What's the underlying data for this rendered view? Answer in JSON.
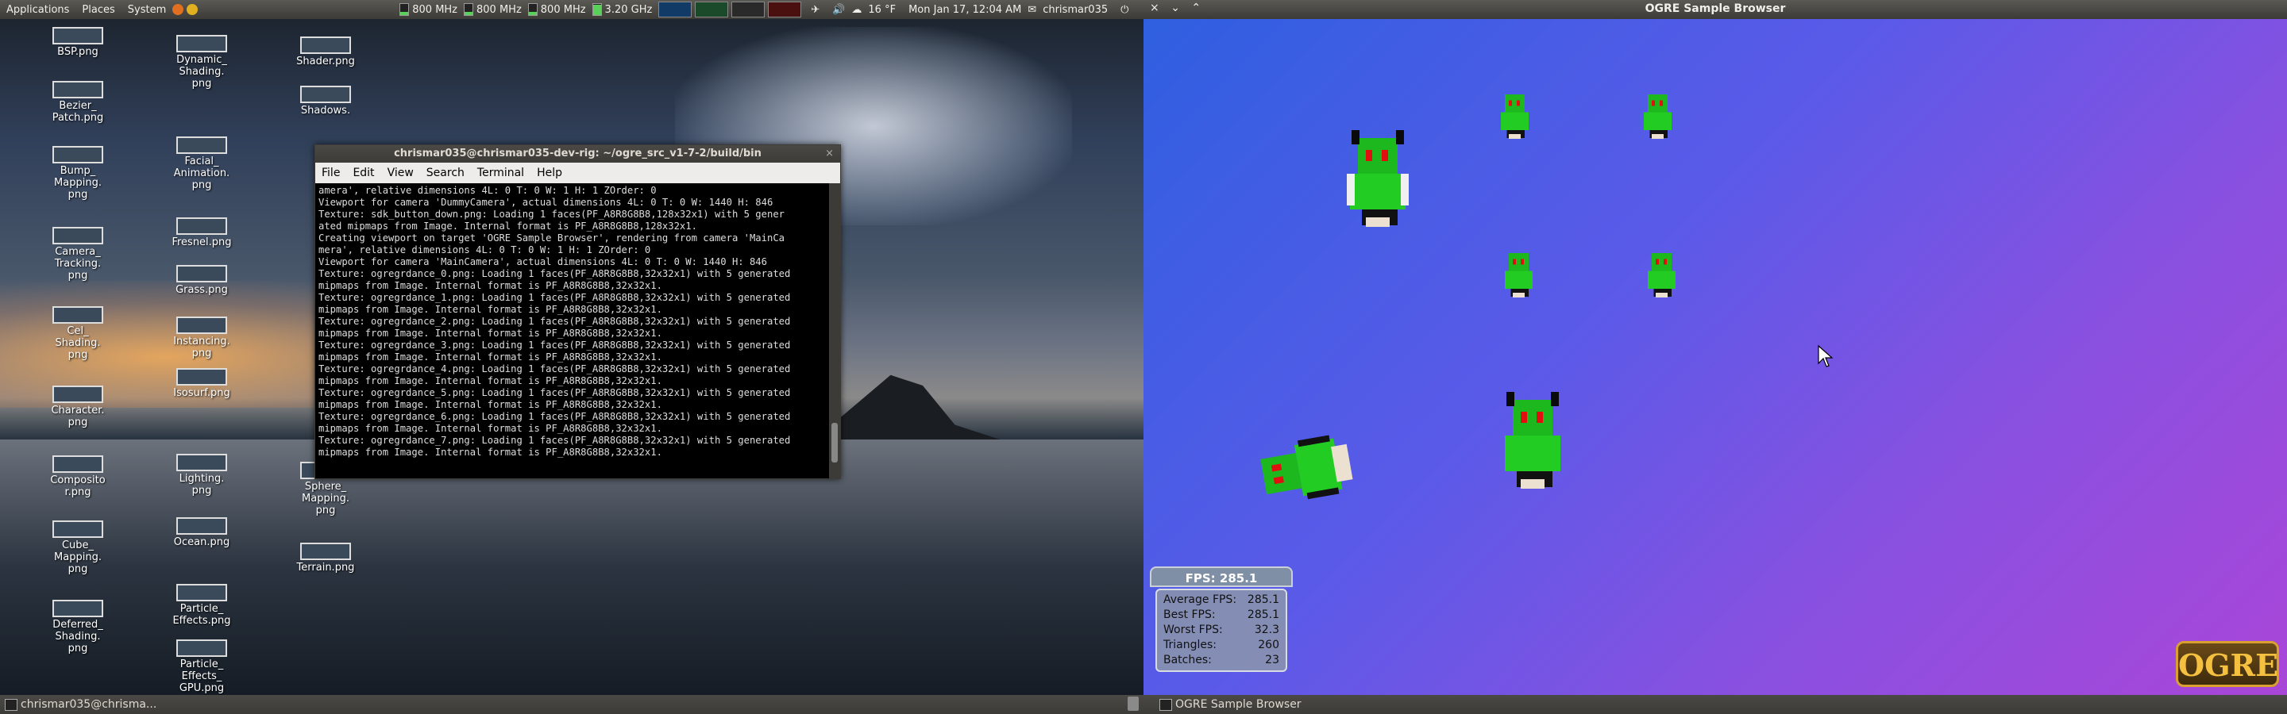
{
  "top_panel": {
    "menus": [
      "Applications",
      "Places",
      "System"
    ],
    "cpu_freqs": [
      "800 MHz",
      "800 MHz",
      "800 MHz",
      "3.20 GHz"
    ],
    "weather": "16 °F",
    "datetime": "Mon Jan 17, 12:04 AM",
    "user": "chrismar035"
  },
  "desktop_icons": [
    "BSP.png",
    "Bezier_\nPatch.png",
    "Bump_\nMapping.\npng",
    "Camera_\nTracking.\npng",
    "Cel_\nShading.\npng",
    "Character.\npng",
    "Composito\nr.png",
    "Cube_\nMapping.\npng",
    "Deferred_\nShading.\npng",
    "Dynamic_\nShading.\npng",
    "Facial_\nAnimation.\npng",
    "Fresnel.png",
    "Grass.png",
    "Instancing.\npng",
    "Isosurf.png",
    "Lighting.\npng",
    "Ocean.png",
    "Particle_\nEffects.png",
    "Particle_\nEffects_\nGPU.png",
    "Shader.png",
    "Shadows.",
    "Sphere_\nMapping.\npng",
    "Terrain.png"
  ],
  "terminal": {
    "title": "chrismar035@chrismar035-dev-rig: ~/ogre_src_v1-7-2/build/bin",
    "menu": [
      "File",
      "Edit",
      "View",
      "Search",
      "Terminal",
      "Help"
    ],
    "lines": [
      "amera', relative dimensions 4L: 0 T: 0 W: 1 H: 1 ZOrder: 0",
      "Viewport for camera 'DummyCamera', actual dimensions 4L: 0 T: 0 W: 1440 H: 846",
      "Texture: sdk_button_down.png: Loading 1 faces(PF_A8R8G8B8,128x32x1) with 5 gener",
      "ated mipmaps from Image. Internal format is PF_A8R8G8B8,128x32x1.",
      "Creating viewport on target 'OGRE Sample Browser', rendering from camera 'MainCa",
      "mera', relative dimensions 4L: 0 T: 0 W: 1 H: 1 ZOrder: 0",
      "Viewport for camera 'MainCamera', actual dimensions 4L: 0 T: 0 W: 1440 H: 846",
      "Texture: ogregrdance_0.png: Loading 1 faces(PF_A8R8G8B8,32x32x1) with 5 generated",
      "mipmaps from Image. Internal format is PF_A8R8G8B8,32x32x1.",
      "Texture: ogregrdance_1.png: Loading 1 faces(PF_A8R8G8B8,32x32x1) with 5 generated",
      "mipmaps from Image. Internal format is PF_A8R8G8B8,32x32x1.",
      "Texture: ogregrdance_2.png: Loading 1 faces(PF_A8R8G8B8,32x32x1) with 5 generated",
      "mipmaps from Image. Internal format is PF_A8R8G8B8,32x32x1.",
      "Texture: ogregrdance_3.png: Loading 1 faces(PF_A8R8G8B8,32x32x1) with 5 generated",
      "mipmaps from Image. Internal format is PF_A8R8G8B8,32x32x1.",
      "Texture: ogregrdance_4.png: Loading 1 faces(PF_A8R8G8B8,32x32x1) with 5 generated",
      "mipmaps from Image. Internal format is PF_A8R8G8B8,32x32x1.",
      "Texture: ogregrdance_5.png: Loading 1 faces(PF_A8R8G8B8,32x32x1) with 5 generated",
      "mipmaps from Image. Internal format is PF_A8R8G8B8,32x32x1.",
      "Texture: ogregrdance_6.png: Loading 1 faces(PF_A8R8G8B8,32x32x1) with 5 generated",
      "mipmaps from Image. Internal format is PF_A8R8G8B8,32x32x1.",
      "Texture: ogregrdance_7.png: Loading 1 faces(PF_A8R8G8B8,32x32x1) with 5 generated",
      "mipmaps from Image. Internal format is PF_A8R8G8B8,32x32x1."
    ]
  },
  "ogre_window": {
    "title": "OGRE Sample Browser",
    "fps": "FPS: 285.1",
    "stats": [
      {
        "label": "Average FPS:",
        "value": "285.1"
      },
      {
        "label": "Best FPS:",
        "value": "285.1"
      },
      {
        "label": "Worst FPS:",
        "value": "32.3"
      },
      {
        "label": "Triangles:",
        "value": "260"
      },
      {
        "label": "Batches:",
        "value": "23"
      }
    ],
    "logo": "OGRE"
  },
  "bottom_panel": {
    "task_terminal": "chrismar035@chrisma...",
    "task_ogre": "OGRE Sample Browser"
  }
}
